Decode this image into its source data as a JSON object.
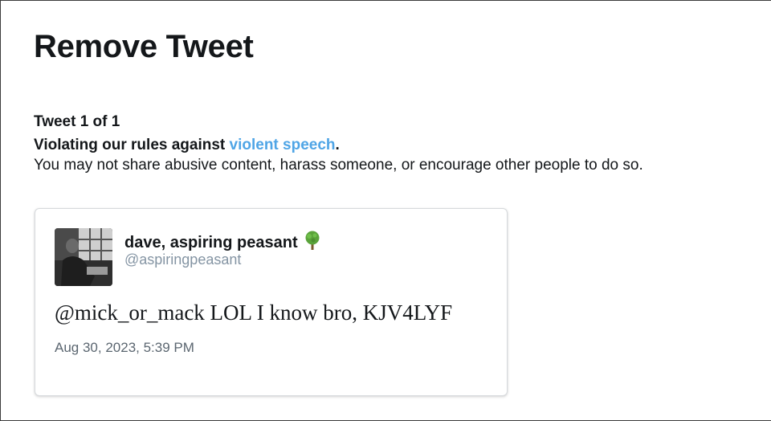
{
  "page": {
    "title": "Remove Tweet",
    "tweet_count": "Tweet 1 of 1",
    "violation_prefix": "Violating our rules against ",
    "violation_link": "violent speech",
    "violation_suffix": ".",
    "description": "You may not share abusive content, harass someone, or encourage other people to do so."
  },
  "tweet": {
    "display_name": "dave, aspiring peasant",
    "name_emoji_icon": "deciduous-tree-icon",
    "handle": "@aspiringpeasant",
    "text": "@mick_or_mack LOL I know bro, KJV4LYF",
    "timestamp": "Aug 30, 2023, 5:39 PM"
  },
  "colors": {
    "link": "#4fa5e6",
    "handle": "#8494a3",
    "text": "#14171a"
  }
}
